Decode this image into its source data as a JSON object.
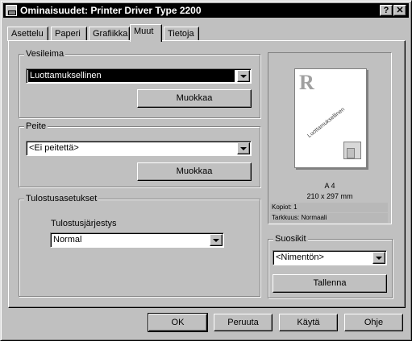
{
  "window": {
    "title": "Ominaisuudet: Printer Driver Type 2200",
    "help_button": "?",
    "close_button": "✕"
  },
  "tabs": [
    {
      "label": "Asettelu"
    },
    {
      "label": "Paperi"
    },
    {
      "label": "Grafiikka"
    },
    {
      "label": "Muut",
      "active": true
    },
    {
      "label": "Tietoja"
    }
  ],
  "watermark": {
    "group_label": "Vesileima",
    "selected": "Luottamuksellinen",
    "edit_button": "Muokkaa"
  },
  "overlay": {
    "group_label": "Peite",
    "selected": "<Ei peitettä>",
    "edit_button": "Muokkaa"
  },
  "output": {
    "group_label": "Tulostusasetukset",
    "order_label": "Tulostusjärjestys",
    "order_selected": "Normal"
  },
  "preview": {
    "letter": "R",
    "watermark_text": "Luottamuksellinen",
    "paper_name": "A 4",
    "paper_size": "210 x 297 mm",
    "copies": "Kopiot: 1",
    "resolution": "Tarkkuus: Normaali"
  },
  "favorites": {
    "group_label": "Suosikit",
    "selected": "<Nimentön>",
    "save_button": "Tallenna"
  },
  "footer": {
    "ok": "OK",
    "cancel": "Peruuta",
    "apply": "Käytä",
    "help": "Ohje"
  }
}
